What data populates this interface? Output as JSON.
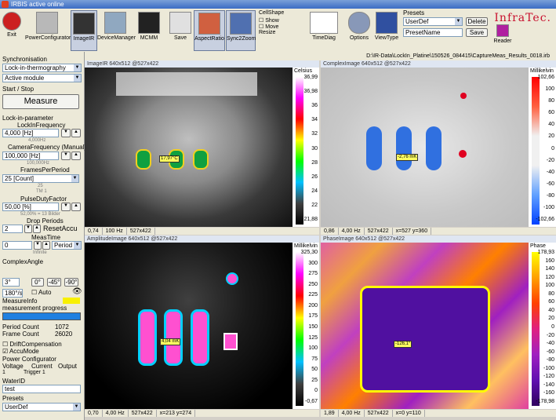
{
  "app": {
    "title": "IRBIS active online"
  },
  "toolbar": {
    "exit": "Exit",
    "power_configurator": "PowerConfigurator",
    "image_ir": "ImageIR",
    "device_manager": "DeviceManager",
    "mcmm": "MCMM",
    "save": "Save",
    "aspect_ratio": "AspectRatio",
    "sync_zoom": "Sync2Zoom",
    "cellshape_title": "CellShape",
    "show": "Show",
    "move_resize": "Move\nResize",
    "time_diag": "TimeDiag",
    "options": "Options",
    "view_type": "ViewType",
    "presets_title": "Presets",
    "preset_value": "UserDef",
    "preset_name": "PresetName",
    "delete": "Delete",
    "save2": "Save",
    "reader": "Reader",
    "logo": "InfraTec."
  },
  "path": "D:\\IR-Data\\LockIn_Platine\\150526_084415\\CaptureMeas_Results_0018.irb",
  "left": {
    "synchronisation": "Synchronisation",
    "sync_mode": "Lock-in-thermography",
    "module": "Active module",
    "start_stop": "Start / Stop",
    "measure": "Measure",
    "lockin_param": "Lock-in-parameter",
    "lockin_freq_label": "LockInFrequency",
    "lockin_freq": "4,000 [Hz]",
    "lockin_freq_sub": "4,000Hz",
    "camera_freq_label": "CameraFrequency (Manual)",
    "camera_freq": "100,000 [Hz]",
    "camera_freq_sub": "100,000Hz",
    "frames_label": "FramesPerPeriod",
    "frames": "25 [Count]",
    "frames_sub1": "25",
    "frames_sub2": "TM 1",
    "duty_label": "PulseDutyFactor",
    "duty": "50,00 [%]",
    "duty_sub": "52,00% = 13 Bilder",
    "drop_label": "Drop Periods",
    "drop": "2",
    "reset": "ResetAccu",
    "meas_time_label": "MeasTime",
    "meas_time": "0",
    "meas_time_unit": "Period",
    "meas_time_sub": "Infinite",
    "complex_angle": "ComplexAngle",
    "angle_val": "3°",
    "angle_0": "0°",
    "angle_m45": "-45°",
    "angle_m90": "-90°",
    "angle_180": "180°/s",
    "auto": "Auto",
    "measure_info": "MeasureInfo",
    "meas_progress": "measurement progress",
    "period_count_label": "Period Count",
    "period_count": "1072",
    "frame_count_label": "Frame Count",
    "frame_count": "26020",
    "drift": "DriftCompensation",
    "accu": "AccuMode",
    "power_conf": "Power Configurator",
    "voltage": "Voltage",
    "current": "Current",
    "output": "Output",
    "row_1": "1",
    "trigger": "Trigger 1",
    "water_id": "WaterID",
    "water_val": "test",
    "presets": "Presets",
    "preset_val": "UserDef"
  },
  "panels": {
    "ir": {
      "title": "ImageIR 640x512 @527x422",
      "unit": "Celsius",
      "ticks": [
        "36,99",
        "36,98",
        "36",
        "34",
        "32",
        "30",
        "28",
        "26",
        "24",
        "22",
        "21,88"
      ],
      "footer": [
        "0,74",
        "100 Hz",
        "527x422"
      ],
      "tag": "17,97°C"
    },
    "complex": {
      "title": "ComplexImage 640x512 @527x422",
      "unit": "Millikelvin",
      "ticks": [
        "102,66",
        "100",
        "80",
        "60",
        "40",
        "20",
        "0",
        "-20",
        "-40",
        "-60",
        "-80",
        "-100",
        "-102,66"
      ],
      "footer": [
        "0,86",
        "4,00 Hz",
        "527x422",
        "x=527 y=360"
      ],
      "tag": "-2,76 mK"
    },
    "amplitude": {
      "title": "AmplitudeImage 640x512 @527x422",
      "unit": "Millikelvin",
      "ticks": [
        "325,30",
        "300",
        "275",
        "250",
        "225",
        "200",
        "175",
        "150",
        "125",
        "100",
        "75",
        "50",
        "25",
        "0",
        "-0,67"
      ],
      "footer": [
        "0,70",
        "4,00 Hz",
        "527x422",
        "x=213 y=274"
      ],
      "tag": "4,04 mK"
    },
    "phase": {
      "title": "PhaseImage 640x512 @527x422",
      "unit": "Phase",
      "ticks": [
        "178,93",
        "160",
        "140",
        "120",
        "100",
        "80",
        "60",
        "40",
        "20",
        "0",
        "-20",
        "-40",
        "-60",
        "-80",
        "-100",
        "-120",
        "-140",
        "-160",
        "-178,98"
      ],
      "footer": [
        "1,89",
        "4,00 Hz",
        "527x422",
        "x=0 y=110"
      ],
      "tag": "-126,1°"
    }
  }
}
